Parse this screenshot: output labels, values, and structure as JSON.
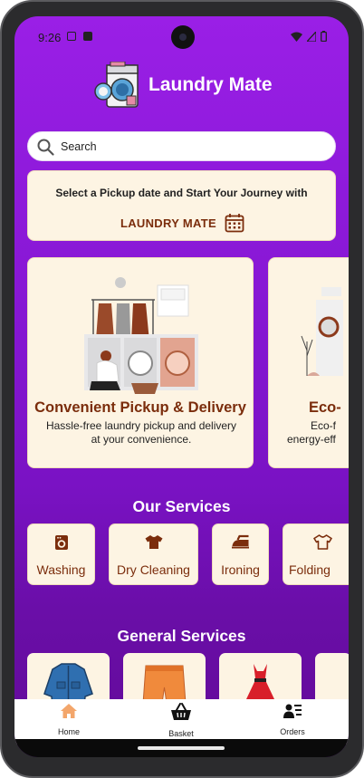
{
  "status_bar": {
    "time": "9:26"
  },
  "header": {
    "title": "Laundry Mate"
  },
  "search": {
    "placeholder": "Search"
  },
  "banner": {
    "line1": "Select a Pickup date and Start Your Journey with",
    "line2": "LAUNDRY MATE"
  },
  "carousel": [
    {
      "title": "Convenient Pickup & Delivery",
      "desc1": "Hassle-free laundry pickup and delivery",
      "desc2": "at your convenience."
    },
    {
      "title": "Eco-",
      "desc1": "Eco-f",
      "desc2": "energy-eff"
    }
  ],
  "services": {
    "title": "Our Services",
    "items": [
      {
        "label": "Washing",
        "icon": "washing-machine-icon"
      },
      {
        "label": "Dry Cleaning",
        "icon": "tshirt-icon"
      },
      {
        "label": "Ironing",
        "icon": "iron-icon"
      },
      {
        "label": "Folding",
        "icon": "shirt-outline-icon"
      }
    ]
  },
  "general": {
    "title": "General Services"
  },
  "nav": {
    "home": "Home",
    "basket": "Basket",
    "orders": "Orders"
  },
  "colors": {
    "accent": "#7b2d0c",
    "card": "#fdf4e3",
    "gradient_top": "#9a1fe6",
    "gradient_bottom": "#620b98",
    "home_active": "#f3a66b"
  }
}
